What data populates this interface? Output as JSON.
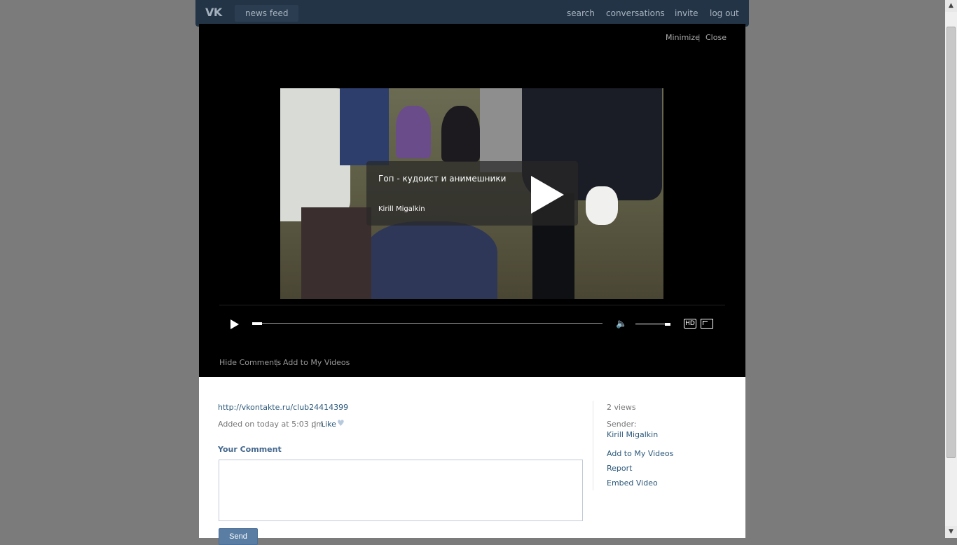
{
  "header": {
    "logo": "VK",
    "nav_feed": "news feed",
    "links": {
      "search": "search",
      "conversations": "conversations",
      "invite": "invite",
      "logout": "log out"
    }
  },
  "viewer": {
    "minimize": "Minimize",
    "separator": "|",
    "close": "Close",
    "video": {
      "title": "Гоп - кудоист и анимешники",
      "author": "Kirill Migalkin"
    },
    "controls": {
      "hd_label": "HD"
    },
    "actions": {
      "hide_comments": "Hide Comments",
      "add_to_my_videos": "Add to My Videos"
    }
  },
  "info": {
    "description_link": "http://vkontakte.ru/club24414399",
    "added_text": "Added on today at 5:03 pm",
    "separator": "|",
    "like_label": "Like",
    "comment_heading": "Your Comment",
    "comment_value": "",
    "send_label": "Send",
    "sidebar": {
      "views": "2 views",
      "sender_label": "Sender:",
      "sender_name": "Kirill Migalkin",
      "add_to_my_videos": "Add to My Videos",
      "report": "Report",
      "embed": "Embed Video"
    }
  },
  "colors": {
    "header_bg": "#233446",
    "viewer_bg": "#000000",
    "link_blue": "#2b587a",
    "button_blue": "#597da3",
    "page_bg": "#7b7b7b"
  }
}
